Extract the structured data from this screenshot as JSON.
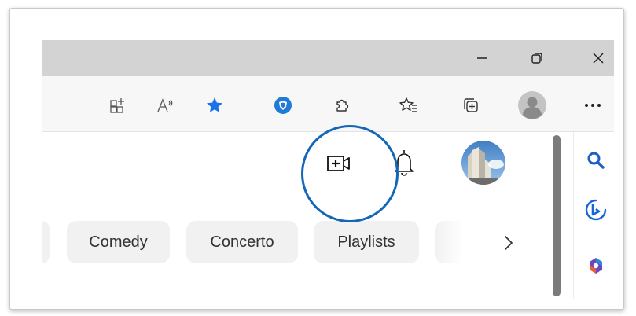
{
  "colors": {
    "accent_blue": "#1466b8",
    "star_blue": "#1a73e8",
    "chip_bg": "#f1f1f1",
    "scroll_thumb": "#7b7b7b"
  },
  "window_controls": {
    "minimize": "minimize-icon",
    "restore": "restore-icon",
    "close": "close-icon"
  },
  "toolbar": {
    "icons": [
      "app-available-icon",
      "read-aloud-icon",
      "favorite-star-icon",
      "extension-shield-icon",
      "extensions-puzzle-icon",
      "favorites-icon",
      "collections-icon",
      "profile-avatar-icon",
      "more-icon"
    ]
  },
  "page": {
    "header_icons": [
      "create-video-icon",
      "notifications-bell-icon",
      "channel-avatar"
    ],
    "chips": [
      "Comedy",
      "Concerto",
      "Playlists"
    ],
    "chip_next": "chevron-right-icon"
  },
  "sidebar": {
    "icons": [
      "search-icon",
      "bing-icon",
      "office-icon"
    ]
  }
}
